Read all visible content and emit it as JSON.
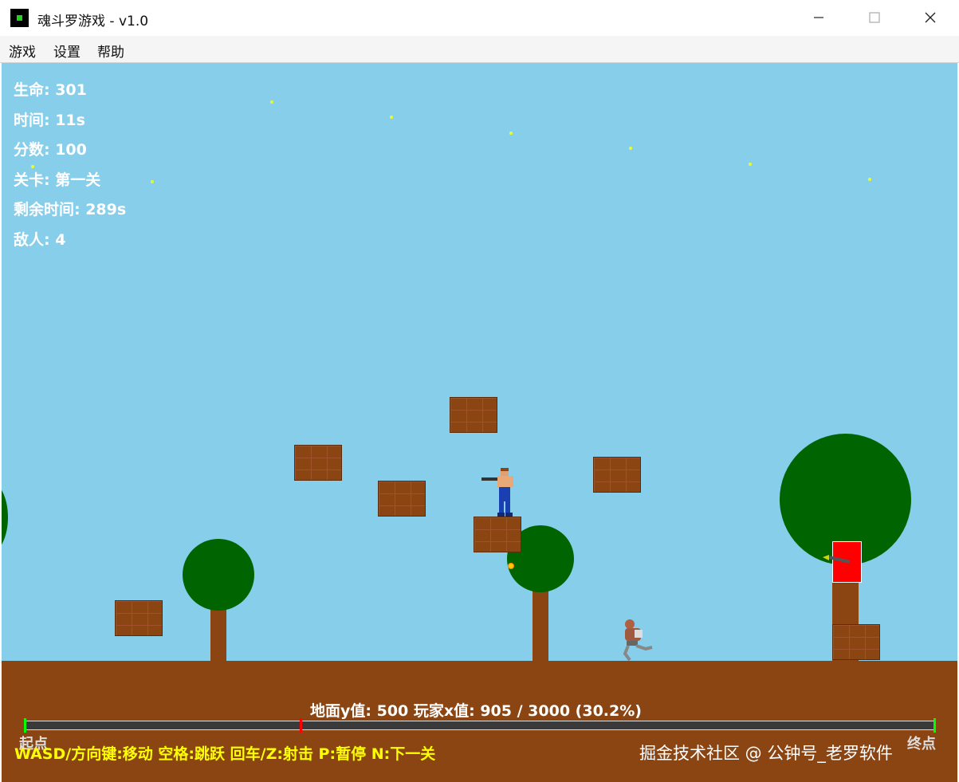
{
  "window": {
    "title": "魂斗罗游戏 - v1.0"
  },
  "menu": {
    "items": [
      "游戏",
      "设置",
      "帮助"
    ]
  },
  "hud": {
    "life": "生命: 301",
    "time": "时间: 11s",
    "score": "分数: 100",
    "level": "关卡: 第一关",
    "remaining": "剩余时间: 289s",
    "enemies": "敌人: 4"
  },
  "progress": {
    "text": "地面y值: 500  玩家x值: 905 / 3000 (30.2%)",
    "fraction": 0.302,
    "start_label": "起点",
    "end_label": "终点"
  },
  "controls_text": "WASD/方向键:移动 空格:跳跃 回车/Z:射击 P:暂停 N:下一关",
  "watermark": "掘金技术社区 @ 公钟号_老罗软件",
  "colors": {
    "sky": "#87ceeb",
    "ground": "#8b4513",
    "tree_canopy": "#006400",
    "hud_text": "#ffffff",
    "controls_text": "#ffff00",
    "enemy_box": "#ff0000",
    "progress_start": "#00ff00",
    "progress_player": "#ff0000"
  }
}
